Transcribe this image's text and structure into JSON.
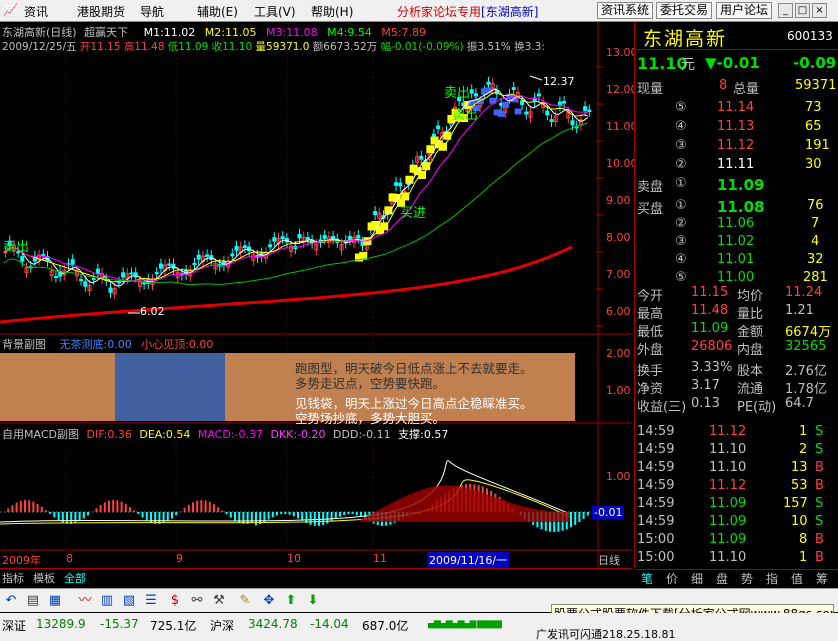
{
  "menu": {
    "items": [
      "资讯",
      "港股期货",
      "导航",
      "辅助(E)",
      "工具(V)",
      "帮助(H)"
    ],
    "title_prefix": "分析家论坛专用",
    "title_stock": "[东湖高新]",
    "buttons": [
      "资讯系统",
      "委托交易",
      "用户论坛"
    ],
    "controls": [
      "_",
      "□",
      "×"
    ]
  },
  "chart": {
    "title": "东湖高新(日线)",
    "formula": "超赢天下",
    "ma": [
      "M1:11.02",
      "M2:11.05",
      "M3:11.08",
      "M4:9.54",
      "M5:7.89"
    ],
    "info_date": "2009/12/25/五",
    "info_open": "开11.15",
    "info_high": "高11.48",
    "info_low": "低11.09",
    "info_close": "收11.10",
    "info_vol": "量59371.0",
    "info_amt": "额6673.52万",
    "info_chg": "幅-0.01(-0.09%)",
    "info_amp": "振3.51%",
    "info_turn": "换3.3:",
    "price_ticks": [
      "13.00",
      "12.00",
      "11.00",
      "10.00",
      "9.00",
      "8.00",
      "7.00",
      "6.00"
    ],
    "high_label": "12.37",
    "low_label": "6.02",
    "sell_label": "卖出",
    "buy_label": "买进",
    "sub1_title": "背景副图",
    "sub1_a": "无茶测底:0.00",
    "sub1_b": "小心见顶:0.00",
    "sub1_ticks": [
      "2.00",
      "1.00"
    ],
    "sub1_lines": [
      "跑图型，明天破今日低点涨上不去就要走。",
      "多势走迟点，空势要快跑。",
      "见钱袋，明天上涨过今日高点企稳睬准买。",
      "空势场抄底，多势大胆买。"
    ],
    "macd_title": "自用MACD副图",
    "macd_vals": [
      "DIF:0.36",
      "DEA:0.54",
      "MACD:-0.37",
      "DKK:-0.20",
      "DDD:-0.11",
      "支撑:0.57"
    ],
    "macd_ticks": [
      "1.00",
      "-0.01"
    ],
    "date_labels": [
      "2009年",
      "8",
      "9",
      "10",
      "11"
    ],
    "date_cursor": "2009/11/16/一",
    "period": "日线"
  },
  "quote": {
    "name": "东湖高新",
    "code": "600133",
    "price": "11.10",
    "unit": "元",
    "change": "▼-0.01",
    "pct": "-0.09",
    "now_vol_label": "现量",
    "now_vol": "8",
    "total_label": "总量",
    "total": "59371",
    "sell_label": "卖盘",
    "buy_label": "买盘",
    "asks": [
      {
        "n": "⑤",
        "p": "11.14",
        "v": "73"
      },
      {
        "n": "④",
        "p": "11.13",
        "v": "65"
      },
      {
        "n": "③",
        "p": "11.12",
        "v": "191"
      },
      {
        "n": "②",
        "p": "11.11",
        "v": "30"
      },
      {
        "n": "①",
        "p": "11.09",
        "v": ""
      }
    ],
    "bids": [
      {
        "n": "①",
        "p": "11.08",
        "v": "76"
      },
      {
        "n": "②",
        "p": "11.06",
        "v": "7"
      },
      {
        "n": "③",
        "p": "11.02",
        "v": "4"
      },
      {
        "n": "④",
        "p": "11.01",
        "v": "32"
      },
      {
        "n": "⑤",
        "p": "11.00",
        "v": "281"
      }
    ],
    "stats": [
      {
        "a": "今开",
        "av": "11.15",
        "b": "均价",
        "bv": "11.24"
      },
      {
        "a": "最高",
        "av": "11.48",
        "b": "量比",
        "bv": "1.21"
      },
      {
        "a": "最低",
        "av": "11.09",
        "b": "金额",
        "bv": "6674万"
      },
      {
        "a": "外盘",
        "av": "26806",
        "b": "内盘",
        "bv": "32565"
      },
      {
        "a": "换手",
        "av": "3.33%",
        "b": "股本",
        "bv": "2.76亿"
      },
      {
        "a": "净资",
        "av": "3.17",
        "b": "流通",
        "bv": "1.78亿"
      },
      {
        "a": "收益(三)",
        "av": "0.13",
        "b": "PE(动)",
        "bv": "64.7"
      }
    ],
    "ticks": [
      {
        "t": "14:59",
        "p": "11.12",
        "v": "1",
        "d": "S"
      },
      {
        "t": "14:59",
        "p": "11.10",
        "v": "2",
        "d": "S"
      },
      {
        "t": "14:59",
        "p": "11.10",
        "v": "13",
        "d": "B"
      },
      {
        "t": "14:59",
        "p": "11.12",
        "v": "53",
        "d": "B"
      },
      {
        "t": "14:59",
        "p": "11.09",
        "v": "157",
        "d": "S"
      },
      {
        "t": "14:59",
        "p": "11.09",
        "v": "10",
        "d": "S"
      },
      {
        "t": "15:00",
        "p": "11.09",
        "v": "8",
        "d": "B"
      },
      {
        "t": "15:00",
        "p": "11.10",
        "v": "1",
        "d": "B"
      }
    ],
    "tabs": [
      "笔",
      "价",
      "细",
      "盘",
      "势",
      "指",
      "值",
      "筹"
    ]
  },
  "bottom_tabs": [
    "指标",
    "模板",
    "全部"
  ],
  "status": {
    "sz_label": "深证",
    "sz_val": "13289.9",
    "sz_chg": "-15.37",
    "sz_amt": "725.1亿",
    "sh_label": "沪深",
    "sh_val": "3424.78",
    "sh_chg": "-14.04",
    "sh_amt": "687.0亿",
    "link": "广发讯可闪通218.25.18.81",
    "ad": "股票公式股票软件下载[分析家公式网www.88gs.com]"
  },
  "colors": {
    "up": "#ff4040",
    "down": "#00e000",
    "text": "#c0c0c0",
    "yellow": "#ffff00",
    "border": "#a00000"
  }
}
